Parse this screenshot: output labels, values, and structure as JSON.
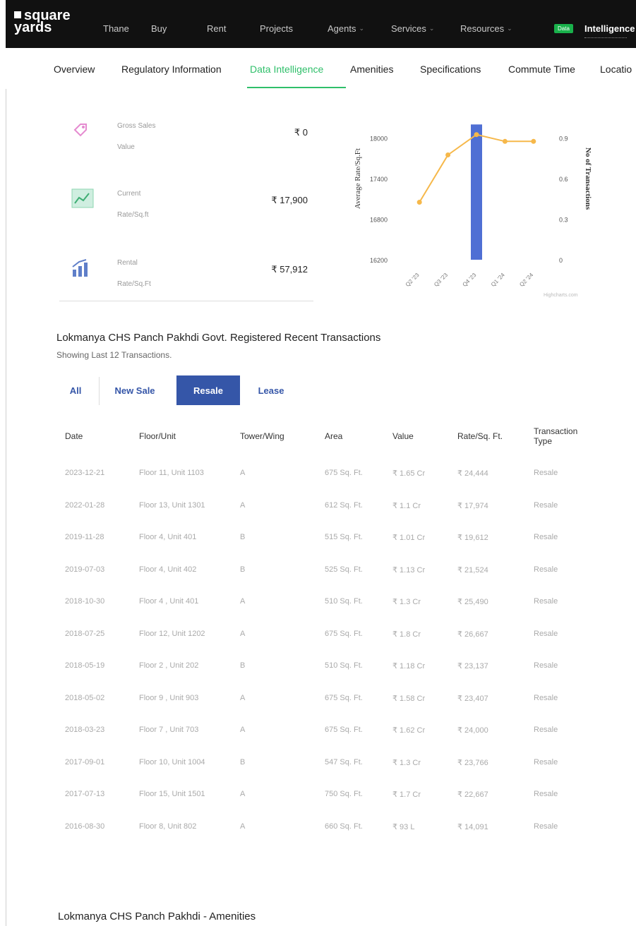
{
  "brand": {
    "line1": "square",
    "line2": "yards"
  },
  "nav": {
    "items": [
      {
        "label": "Thane",
        "chev": ""
      },
      {
        "label": "Buy",
        "chev": ""
      },
      {
        "label": "Rent",
        "chev": ""
      },
      {
        "label": "Projects",
        "chev": ""
      },
      {
        "label": "Agents",
        "chev": "⌄"
      },
      {
        "label": "Services",
        "chev": "⌄"
      },
      {
        "label": "Resources",
        "chev": "⌄"
      }
    ],
    "badge": "Data",
    "intelligence": "Intelligence"
  },
  "tabs": [
    "Overview",
    "Regulatory Information",
    "Data Intelligence",
    "Amenities",
    "Specifications",
    "Commute Time",
    "Locatio"
  ],
  "stats": [
    {
      "label_1": "Gross Sales",
      "label_2": "Value",
      "value": "₹ 0",
      "icon": "tag-icon"
    },
    {
      "label_1": "Current",
      "label_2": "Rate/Sq.ft",
      "value": "₹ 17,900",
      "icon": "chart-board-icon"
    },
    {
      "label_1": "Rental",
      "label_2": "Rate/Sq.Ft",
      "value": "₹ 57,912",
      "icon": "bar-growth-icon"
    }
  ],
  "chart_data": {
    "type": "bar",
    "categories": [
      "Q2 '23",
      "Q3 '23",
      "Q4 '23",
      "Q1 '24",
      "Q2 '24"
    ],
    "category_labels": [
      "Q2 '23",
      "Q3 '23",
      "Q4 '23",
      "Q1 '24",
      "Q2 '24"
    ],
    "series": [
      {
        "kind": "bar",
        "axis": "right",
        "color": "#4f6fd4",
        "values": [
          0,
          0,
          1,
          0,
          0
        ]
      },
      {
        "kind": "line",
        "axis": "left",
        "color": "#f6b84a",
        "values": [
          17050,
          17750,
          18050,
          17950,
          17950
        ]
      }
    ],
    "ylabel": "Average Rate/Sq.Ft",
    "ylabel_right": "No of Transactions",
    "yticks": [
      16200,
      16800,
      17400,
      18000
    ],
    "yticks_right": [
      "0",
      "0.3",
      "0.6",
      "0.9"
    ],
    "ylim": [
      16200,
      18600
    ],
    "ylim_right": [
      0,
      1.2
    ],
    "credit": "Highcharts.com",
    "grid": false
  },
  "transactions": {
    "title": "Lokmanya CHS Panch Pakhdi Govt. Registered Recent Transactions",
    "subtitle": "Showing Last 12 Transactions.",
    "filters": [
      "All",
      "New Sale",
      "Resale",
      "Lease"
    ],
    "active_filter": "Resale",
    "headers": [
      "Date",
      "Floor/Unit",
      "Tower/Wing",
      "Area",
      "Value",
      "Rate/Sq. Ft.",
      "Transaction Type"
    ],
    "rows": [
      [
        "2023-12-21",
        "Floor 11, Unit 1103",
        "A",
        "675 Sq. Ft.",
        "₹ 1.65 Cr",
        "₹ 24,444",
        "Resale"
      ],
      [
        "2022-01-28",
        "Floor 13, Unit 1301",
        "A",
        "612 Sq. Ft.",
        "₹ 1.1 Cr",
        "₹ 17,974",
        "Resale"
      ],
      [
        "2019-11-28",
        "Floor 4, Unit 401",
        "B",
        "515 Sq. Ft.",
        "₹ 1.01 Cr",
        "₹ 19,612",
        "Resale"
      ],
      [
        "2019-07-03",
        "Floor 4, Unit 402",
        "B",
        "525 Sq. Ft.",
        "₹ 1.13 Cr",
        "₹ 21,524",
        "Resale"
      ],
      [
        "2018-10-30",
        "Floor 4 , Unit 401",
        "A",
        "510 Sq. Ft.",
        "₹ 1.3 Cr",
        "₹ 25,490",
        "Resale"
      ],
      [
        "2018-07-25",
        "Floor 12, Unit 1202",
        "A",
        "675 Sq. Ft.",
        "₹ 1.8 Cr",
        "₹ 26,667",
        "Resale"
      ],
      [
        "2018-05-19",
        "Floor 2 , Unit 202",
        "B",
        "510 Sq. Ft.",
        "₹ 1.18 Cr",
        "₹ 23,137",
        "Resale"
      ],
      [
        "2018-05-02",
        "Floor 9 , Unit 903",
        "A",
        "675 Sq. Ft.",
        "₹ 1.58 Cr",
        "₹ 23,407",
        "Resale"
      ],
      [
        "2018-03-23",
        "Floor 7 , Unit 703",
        "A",
        "675 Sq. Ft.",
        "₹ 1.62 Cr",
        "₹ 24,000",
        "Resale"
      ],
      [
        "2017-09-01",
        "Floor 10, Unit 1004",
        "B",
        "547 Sq. Ft.",
        "₹ 1.3 Cr",
        "₹ 23,766",
        "Resale"
      ],
      [
        "2017-07-13",
        "Floor 15, Unit 1501",
        "A",
        "750 Sq. Ft.",
        "₹ 1.7 Cr",
        "₹ 22,667",
        "Resale"
      ],
      [
        "2016-08-30",
        "Floor 8, Unit 802",
        "A",
        "660 Sq. Ft.",
        "₹ 93 L",
        "₹ 14,091",
        "Resale"
      ]
    ]
  },
  "amenities_title": "Lokmanya CHS Panch Pakhdi - Amenities"
}
